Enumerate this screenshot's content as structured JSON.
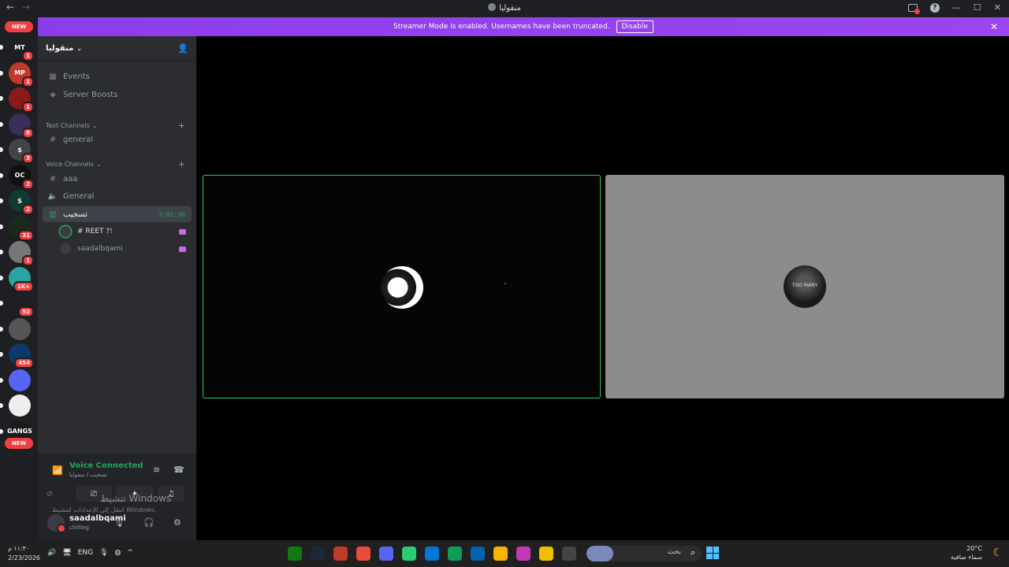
{
  "titlebar": {
    "back": "←",
    "forward": "→",
    "server_name": "منقوليا"
  },
  "banner": {
    "text": "Streamer Mode is enabled. Usernames have been truncated.",
    "button": "Disable"
  },
  "rail": {
    "new_top": "NEW",
    "new_bottom": "NEW",
    "guilds": [
      {
        "abbr": "MT",
        "badge": "1",
        "color": "#1e1f22"
      },
      {
        "abbr": "MP",
        "badge": "1",
        "color": "#c0392b"
      },
      {
        "abbr": "",
        "badge": "1",
        "color": "#8b1a1a"
      },
      {
        "abbr": "",
        "badge": "8",
        "color": "#3a2f5a"
      },
      {
        "abbr": "$",
        "badge": "3",
        "color": "#444"
      },
      {
        "abbr": "OC",
        "badge": "2",
        "color": "#111"
      },
      {
        "abbr": "S",
        "badge": "2",
        "color": "#0e3b2e"
      },
      {
        "abbr": "",
        "badge": "31",
        "color": "#1a2a1a"
      },
      {
        "abbr": "",
        "badge": "1",
        "color": "#777"
      },
      {
        "abbr": "",
        "badge": "1K+",
        "color": "#2aa3a3"
      },
      {
        "abbr": "",
        "badge": "92",
        "color": "#1e1f22"
      },
      {
        "abbr": "",
        "badge": "",
        "color": "#555"
      },
      {
        "abbr": "",
        "badge": "454",
        "color": "#0b3a6a"
      },
      {
        "abbr": "",
        "badge": "",
        "color": "#5865f2"
      },
      {
        "abbr": "",
        "badge": "",
        "color": "#eee"
      },
      {
        "abbr": "GANGS",
        "badge": "",
        "color": "#1a1a1a"
      }
    ]
  },
  "sidebar": {
    "server_name": "منقوليا",
    "events": "Events",
    "server_boosts": "Server Boosts",
    "text_channels": "Text Channels",
    "voice_channels": "Voice Channels",
    "channels": {
      "general_text": "general",
      "aaa": "aaa",
      "general_voice": "General",
      "active_voice": "تسجيب",
      "timer": "2:02:36"
    },
    "voice_users": [
      "# REET ?!",
      "saadalbqami"
    ]
  },
  "voice_panel": {
    "title": "Voice Connected",
    "subtitle": "تسجيب / منقوليا"
  },
  "user_panel": {
    "name": "saadalbqami",
    "status": "chilling"
  },
  "watermark": {
    "line1": "تنشيط Windows",
    "line2": "انتقل إلى الإعدادات لتنشيط Windows."
  },
  "stage": {
    "tile_b_avatar_text": "TOO MANY"
  },
  "taskbar": {
    "time": "١١:٣٠ م",
    "date": "2/23/2026",
    "lang": "ENG",
    "search": "بحث",
    "temp": "20°C",
    "weather": "سماء صافية",
    "apps": [
      "#0f7b0f",
      "#1b2838",
      "#c0392b",
      "#e74c3c",
      "#5865f2",
      "#2ecc71",
      "#0078d4",
      "#0f9d58",
      "#0063b1",
      "#f4b400",
      "#c239b3",
      "#f0c000",
      "#444"
    ]
  }
}
